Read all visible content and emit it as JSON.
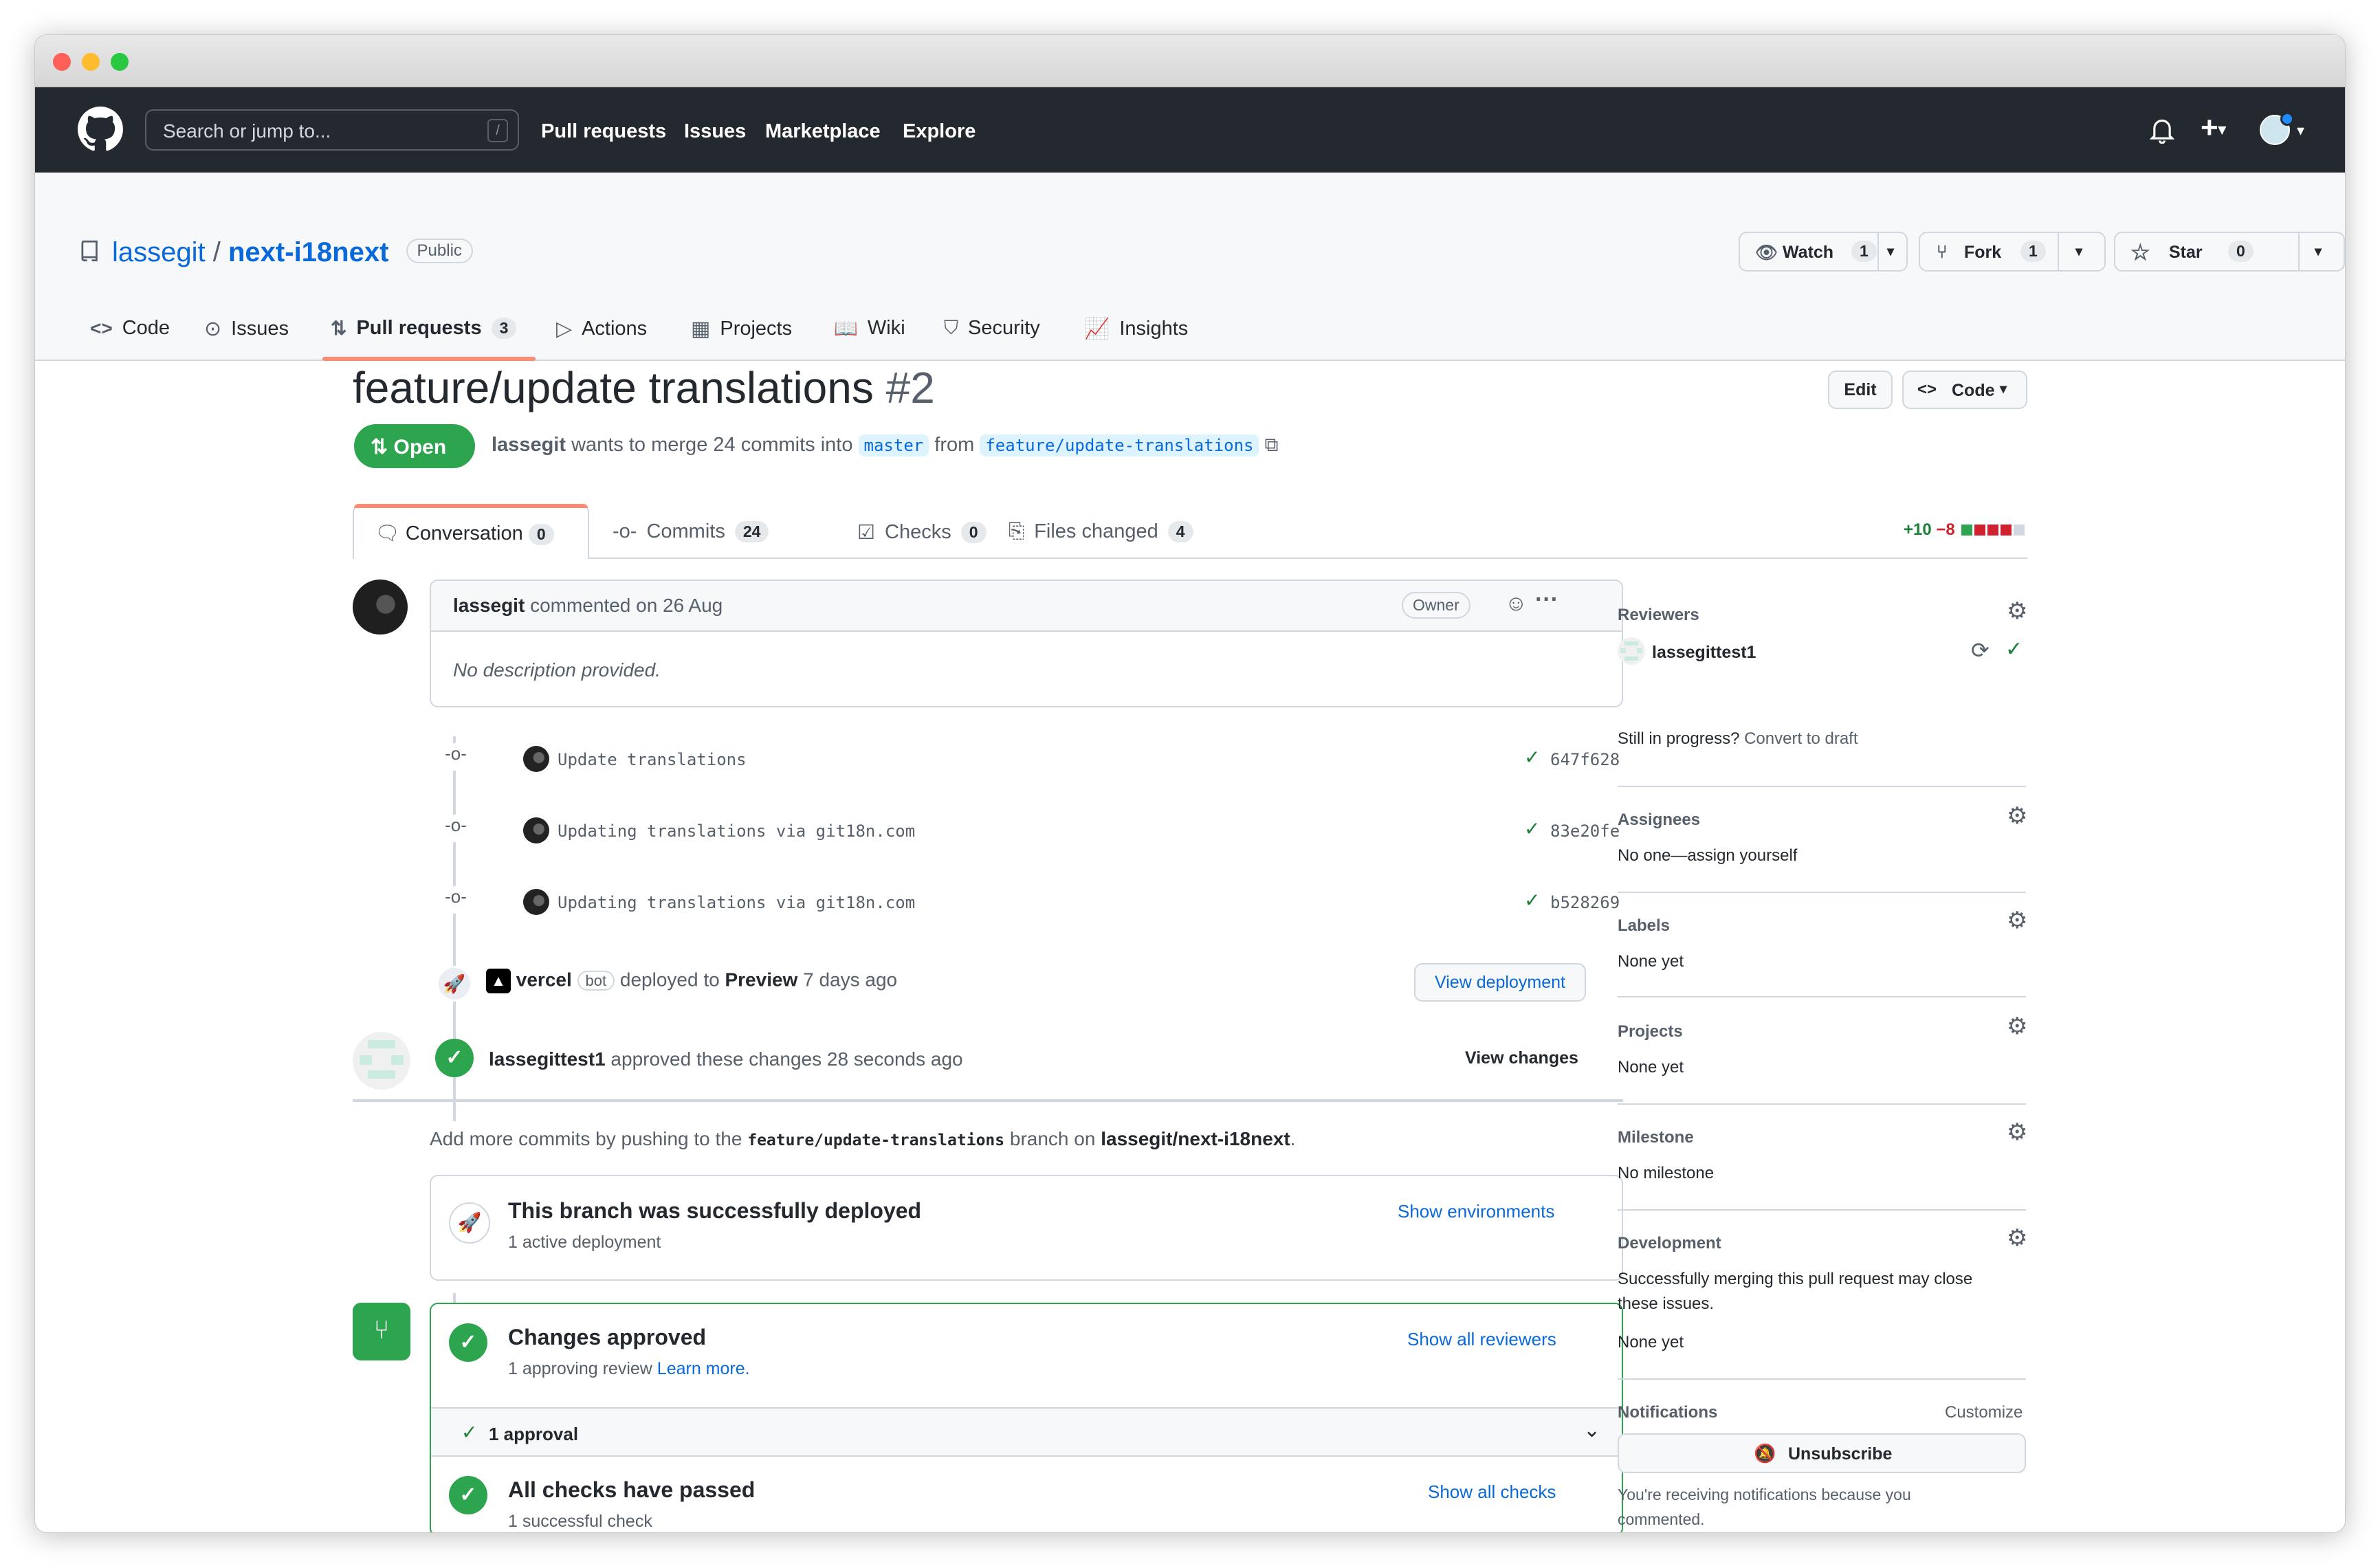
{
  "header": {
    "search_placeholder": "Search or jump to...",
    "search_shortcut": "/",
    "nav": [
      "Pull requests",
      "Issues",
      "Marketplace",
      "Explore"
    ]
  },
  "repo": {
    "owner": "lassegit",
    "separator": "/",
    "name": "next-i18next",
    "visibility": "Public",
    "watch_label": "Watch",
    "watch_count": "1",
    "fork_label": "Fork",
    "fork_count": "1",
    "star_label": "Star",
    "star_count": "0",
    "tabs": [
      {
        "label": "Code",
        "icon": "code-icon"
      },
      {
        "label": "Issues",
        "icon": "issue-icon"
      },
      {
        "label": "Pull requests",
        "icon": "pull-request-icon",
        "count": "3"
      },
      {
        "label": "Actions",
        "icon": "play-icon"
      },
      {
        "label": "Projects",
        "icon": "table-icon"
      },
      {
        "label": "Wiki",
        "icon": "book-icon"
      },
      {
        "label": "Security",
        "icon": "shield-icon"
      },
      {
        "label": "Insights",
        "icon": "graph-icon"
      }
    ]
  },
  "pr": {
    "title": "feature/update translations",
    "number": "#2",
    "edit_label": "Edit",
    "code_label": "Code",
    "state": "Open",
    "author": "lassegit",
    "merge_text": "wants to merge 24 commits into",
    "base_branch": "master",
    "from_text": "from",
    "head_branch": "feature/update-translations",
    "tabs": [
      {
        "label": "Conversation",
        "count": "0"
      },
      {
        "label": "Commits",
        "count": "24"
      },
      {
        "label": "Checks",
        "count": "0"
      },
      {
        "label": "Files changed",
        "count": "4"
      }
    ],
    "additions": "+10",
    "deletions": "−8",
    "diffstat_colors": [
      "#2da44e",
      "#cf222e",
      "#cf222e",
      "#cf222e",
      "#d0d7de"
    ]
  },
  "comment": {
    "author": "lassegit",
    "meta": "commented on 26 Aug",
    "role": "Owner",
    "body": "No description provided."
  },
  "commits": [
    {
      "message": "Update translations",
      "sha": "647f628"
    },
    {
      "message": "Updating translations via git18n.com",
      "sha": "83e20fe"
    },
    {
      "message": "Updating translations via git18n.com",
      "sha": "b528269"
    }
  ],
  "deployment": {
    "actor": "vercel",
    "badge": "bot",
    "text": "deployed to",
    "env": "Preview",
    "time": "7 days ago",
    "button": "View deployment"
  },
  "review": {
    "reviewer": "lassegittest1",
    "text": "approved these changes 28 seconds ago",
    "link": "View changes"
  },
  "push_hint": {
    "pre": "Add more commits by pushing to the",
    "branch": "feature/update-translations",
    "mid": "branch on",
    "repo": "lassegit/next-i18next",
    "post": "."
  },
  "deploy_box": {
    "title": "This branch was successfully deployed",
    "subtitle": "1 active deployment",
    "link": "Show environments"
  },
  "merge_box": {
    "approved_title": "Changes approved",
    "approved_sub": "1 approving review",
    "learn_more": "Learn more.",
    "show_reviewers": "Show all reviewers",
    "approval_row": "1 approval",
    "checks_title": "All checks have passed",
    "checks_sub": "1 successful check",
    "show_checks": "Show all checks"
  },
  "sidebar": {
    "reviewers_h": "Reviewers",
    "reviewer_name": "lassegittest1",
    "draft_q": "Still in progress?",
    "draft_link": "Convert to draft",
    "assignees_h": "Assignees",
    "assignees_v": "No one—assign yourself",
    "labels_h": "Labels",
    "labels_v": "None yet",
    "projects_h": "Projects",
    "projects_v": "None yet",
    "milestone_h": "Milestone",
    "milestone_v": "No milestone",
    "development_h": "Development",
    "development_line1": "Successfully merging this pull request may close",
    "development_line2": "these issues.",
    "development_v": "None yet",
    "notifications_h": "Notifications",
    "customize": "Customize",
    "unsubscribe": "Unsubscribe",
    "notif_line1": "You're receiving notifications because you",
    "notif_line2": "commented."
  }
}
